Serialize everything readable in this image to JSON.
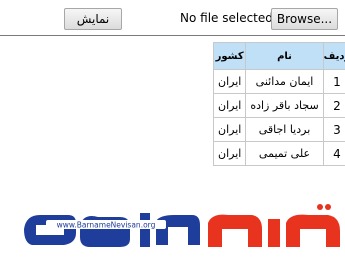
{
  "toolbar": {
    "show_label": "نمایش",
    "browse_label": "Browse...",
    "file_status": "No file selected."
  },
  "table": {
    "headers": [
      "ردیف",
      "نام",
      "کشور"
    ],
    "rows": [
      [
        "1",
        "ایمان مدائنی",
        "ایران"
      ],
      [
        "2",
        "سجاد باقر زاده",
        "ایران"
      ],
      [
        "3",
        "بردیا اجاقی",
        "ایران"
      ],
      [
        "4",
        "علی تمیمی",
        "ایران"
      ]
    ]
  },
  "logo": {
    "url_text": "www.BarnameNevisan.org",
    "colors": {
      "blue": "#1f3d9b",
      "red": "#e8331f"
    }
  }
}
